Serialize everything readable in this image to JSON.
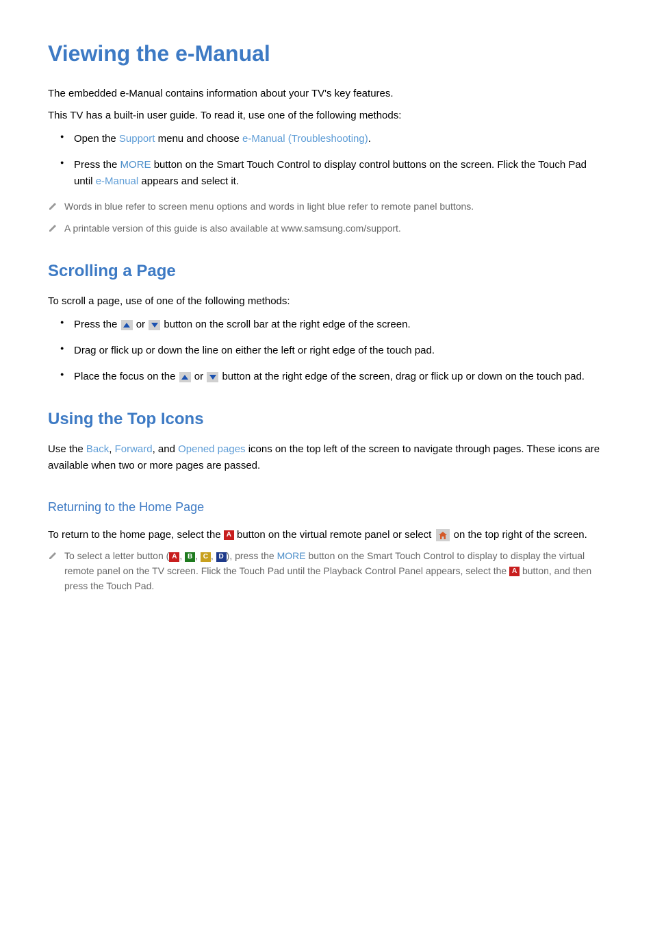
{
  "h1": "Viewing the e-Manual",
  "intro_line1": "The embedded e-Manual contains information about your TV's key features.",
  "intro_line2": "This TV has a built-in user guide. To read it, use one of the following methods:",
  "bullets_intro": {
    "b1_pre": "Open the ",
    "b1_term1": "Support",
    "b1_mid": " menu and choose ",
    "b1_term2": "e-Manual (Troubleshooting)",
    "b1_post": ".",
    "b2_pre": "Press the ",
    "b2_term1": "MORE",
    "b2_mid": " button on the Smart Touch Control to display control buttons on the screen. Flick the Touch Pad until ",
    "b2_term2": "e-Manual",
    "b2_post": " appears and select it."
  },
  "note1": "Words in blue refer to screen menu options and words in light blue refer to remote panel buttons.",
  "note2": "A printable version of this guide is also available at www.samsung.com/support.",
  "h2_scroll": "Scrolling a Page",
  "scroll_lead": "To scroll a page, use of one of the following methods:",
  "scroll_bullets": {
    "b1_pre": "Press the ",
    "b1_mid": " or ",
    "b1_post": " button on the scroll bar at the right edge of the screen.",
    "b2": "Drag or flick up or down the line on either the left or right edge of the touch pad.",
    "b3_pre": "Place the focus on the ",
    "b3_mid": " or ",
    "b3_post": " button at the right edge of the screen, drag or flick up or down on the touch pad."
  },
  "h2_icons": "Using the Top Icons",
  "icons_lead_pre": "Use the ",
  "icons_term_back": "Back",
  "icons_sep1": ", ",
  "icons_term_forward": "Forward",
  "icons_sep2": ", and ",
  "icons_term_opened": "Opened pages",
  "icons_lead_post": " icons on the top left of the screen to navigate through pages. These icons are available when two or more pages are passed.",
  "h3_return": "Returning to the Home Page",
  "return_pre": "To return to the home page, select the ",
  "return_mid": " button on the virtual remote panel or select ",
  "return_post": " on the top right of the screen.",
  "note3_pre": "To select a letter button (",
  "note3_sep": ", ",
  "note3_mid1": "), press the ",
  "note3_term_more": "MORE",
  "note3_mid2": " button on the Smart Touch Control to display to display the virtual remote panel on the TV screen. Flick the Touch Pad until the Playback Control Panel appears, select the ",
  "note3_post": " button, and then press the Touch Pad.",
  "letters": {
    "a": "A",
    "b": "B",
    "c": "C",
    "d": "D"
  }
}
